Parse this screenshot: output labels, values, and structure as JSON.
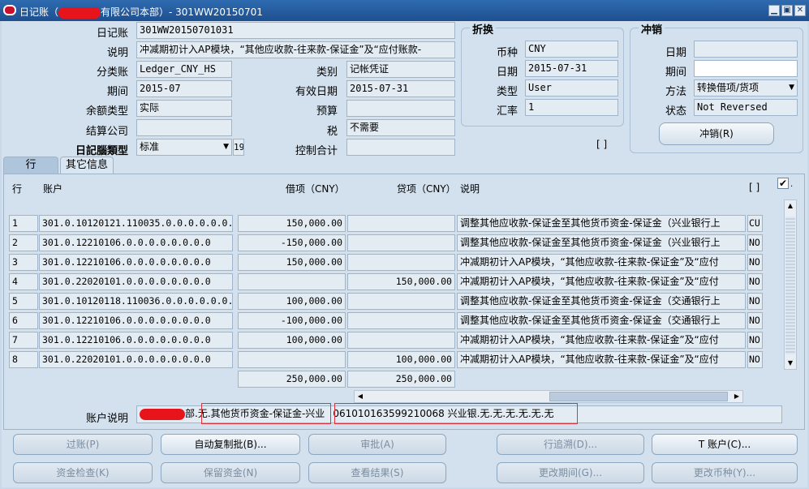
{
  "window": {
    "title_prefix": "日记账（",
    "title_suffix": "有限公司本部）- 301WW20150701",
    "min": "▁",
    "max": "▣",
    "close": "✕"
  },
  "header": {
    "journal_label": "日记账",
    "journal_value": "301WW20150701031",
    "desc_label": "说明",
    "desc_value": "冲减期初计入AP模块，“其他应收款-往来款-保证金”及“应付账款-",
    "ledger_label": "分类账",
    "ledger_value": "Ledger_CNY_HS",
    "category_label": "类别",
    "category_value": "记帐凭证",
    "period_label": "期间",
    "period_value": "2015-07",
    "effdate_label": "有效日期",
    "effdate_value": "2015-07-31",
    "baltype_label": "余额类型",
    "baltype_value": "实际",
    "budget_label": "预算",
    "budget_value": "",
    "settle_label": "结算公司",
    "settle_value": "",
    "tax_label": "税",
    "tax_value": "不需要",
    "type_label": "日記腦類型",
    "type_value": "标准",
    "type_extra": "19",
    "control_label": "控制合计",
    "control_value": ""
  },
  "conversion": {
    "group_title": "折换",
    "currency_label": "币种",
    "currency_value": "CNY",
    "date_label": "日期",
    "date_value": "2015-07-31",
    "type_label": "类型",
    "type_value": "User",
    "rate_label": "汇率",
    "rate_value": "1",
    "bracket": "[ ]"
  },
  "reversal": {
    "group_title": "冲销",
    "date_label": "日期",
    "date_value": "",
    "period_label": "期间",
    "period_value": "",
    "method_label": "方法",
    "method_value": "转换借项/货项",
    "status_label": "状态",
    "status_value": "Not Reversed",
    "button": "冲销(R)"
  },
  "tabs": [
    {
      "label": "行"
    },
    {
      "label": "其它信息"
    }
  ],
  "lines": {
    "headers": {
      "line": "行",
      "account": "账户",
      "debit": "借项（CNY）",
      "credit": "贷项（CNY）",
      "desc": "说明",
      "flag": "[ ]"
    },
    "rows": [
      {
        "line": "1",
        "account": "301.0.10120121.110035.0.0.0.0.0.0.0",
        "debit": "150,000.00",
        "credit": "",
        "desc": "调整其他应收款-保证金至其他货币资金-保证金（兴业银行上",
        "flag": "CU"
      },
      {
        "line": "2",
        "account": "301.0.12210106.0.0.0.0.0.0.0.0",
        "debit": "-150,000.00",
        "credit": "",
        "desc": "调整其他应收款-保证金至其他货币资金-保证金（兴业银行上",
        "flag": "NO"
      },
      {
        "line": "3",
        "account": "301.0.12210106.0.0.0.0.0.0.0.0",
        "debit": "150,000.00",
        "credit": "",
        "desc": "冲减期初计入AP模块，“其他应收款-往来款-保证金”及“应付",
        "flag": "NO"
      },
      {
        "line": "4",
        "account": "301.0.22020101.0.0.0.0.0.0.0.0",
        "debit": "",
        "credit": "150,000.00",
        "desc": "冲减期初计入AP模块，“其他应收款-往来款-保证金”及“应付",
        "flag": "NO"
      },
      {
        "line": "5",
        "account": "301.0.10120118.110036.0.0.0.0.0.0.0",
        "debit": "100,000.00",
        "credit": "",
        "desc": "调整其他应收款-保证金至其他货币资金-保证金（交通银行上",
        "flag": "NO"
      },
      {
        "line": "6",
        "account": "301.0.12210106.0.0.0.0.0.0.0.0",
        "debit": "-100,000.00",
        "credit": "",
        "desc": "调整其他应收款-保证金至其他货币资金-保证金（交通银行上",
        "flag": "NO"
      },
      {
        "line": "7",
        "account": "301.0.12210106.0.0.0.0.0.0.0.0",
        "debit": "100,000.00",
        "credit": "",
        "desc": "冲减期初计入AP模块，“其他应收款-往来款-保证金”及“应付",
        "flag": "NO"
      },
      {
        "line": "8",
        "account": "301.0.22020101.0.0.0.0.0.0.0.0",
        "debit": "",
        "credit": "100,000.00",
        "desc": "冲减期初计入AP模块，“其他应收款-往来款-保证金”及“应付",
        "flag": "NO"
      }
    ],
    "total_debit": "250,000.00",
    "total_credit": "250,000.00"
  },
  "account_desc": {
    "label": "账户说明",
    "seg_prefix": "部.无.",
    "seg_highlight1": "其他货币资金-保证金-兴业",
    "seg_highlight2": "0610",
    "seg_highlight2b": "10163599210068",
    "seg_rest": " 兴业银.无.无.无.无.无.无"
  },
  "buttons": {
    "post": "过账(P)",
    "autocopy": "自动复制批(B)...",
    "approve": "审批(A)",
    "line_drill": "行追溯(D)...",
    "t_account": "T 账户(C)...",
    "funds_check": "资金检查(K)",
    "reserve_funds": "保留资金(N)",
    "view_results": "查看结果(S)",
    "change_period": "更改期间(G)...",
    "change_currency": "更改币种(Y)..."
  }
}
